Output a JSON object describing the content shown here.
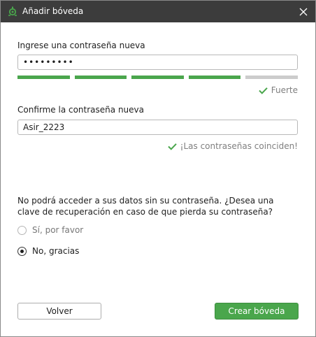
{
  "window": {
    "title": "Añadir bóveda",
    "app_icon": "vault-logo-icon",
    "close_icon": "close-icon"
  },
  "new_password": {
    "label": "Ingrese una contraseña nueva",
    "value": "•••••••••",
    "strength_level": 4,
    "strength_max": 5,
    "strength_text": "Fuerte"
  },
  "confirm_password": {
    "label": "Confirme la contraseña nueva",
    "value": "Asir_2223",
    "match_text": "¡Las contraseñas coinciden!"
  },
  "recovery": {
    "question": "No podrá acceder a sus datos sin su contraseña. ¿Desea una clave de recuperación en caso de que pierda su contraseña?",
    "options": [
      {
        "label": "Sí, por favor",
        "selected": false
      },
      {
        "label": "No, gracias",
        "selected": true
      }
    ]
  },
  "buttons": {
    "back": "Volver",
    "create": "Crear bóveda"
  },
  "colors": {
    "accent": "#4aa64c",
    "titlebar": "#3c3c3c",
    "status_text": "#7f7f7f"
  }
}
